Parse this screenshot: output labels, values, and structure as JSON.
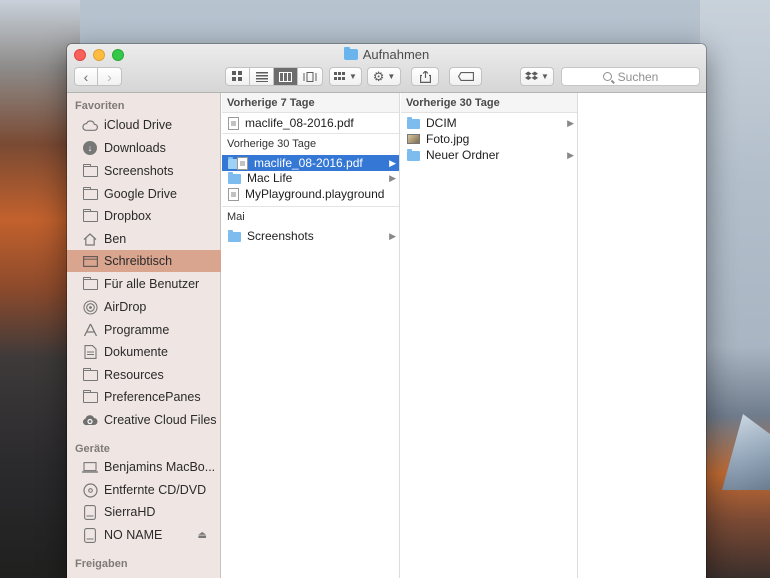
{
  "window": {
    "title": "Aufnahmen"
  },
  "toolbar": {
    "back": "‹",
    "forward": "›",
    "search_placeholder": "Suchen"
  },
  "sidebar": {
    "favorites_label": "Favoriten",
    "favorites": [
      {
        "label": "iCloud Drive",
        "icon": "cloud-icon"
      },
      {
        "label": "Downloads",
        "icon": "download-icon"
      },
      {
        "label": "Screenshots",
        "icon": "folder-icon"
      },
      {
        "label": "Google Drive",
        "icon": "folder-icon"
      },
      {
        "label": "Dropbox",
        "icon": "folder-icon"
      },
      {
        "label": "Ben",
        "icon": "home-icon"
      },
      {
        "label": "Schreibtisch",
        "icon": "desktop-icon",
        "selected": true
      },
      {
        "label": "Für alle Benutzer",
        "icon": "folder-icon"
      },
      {
        "label": "AirDrop",
        "icon": "airdrop-icon"
      },
      {
        "label": "Programme",
        "icon": "apps-icon"
      },
      {
        "label": "Dokumente",
        "icon": "document-icon"
      },
      {
        "label": "Resources",
        "icon": "folder-icon"
      },
      {
        "label": "PreferencePanes",
        "icon": "folder-icon"
      },
      {
        "label": "Creative Cloud Files",
        "icon": "creative-cloud-icon"
      }
    ],
    "devices_label": "Geräte",
    "devices": [
      {
        "label": "Benjamins MacBo...",
        "icon": "laptop-icon"
      },
      {
        "label": "Entfernte CD/DVD",
        "icon": "disc-icon"
      },
      {
        "label": "SierraHD",
        "icon": "disk-icon"
      },
      {
        "label": "NO NAME",
        "icon": "disk-icon",
        "ejectable": true
      }
    ],
    "shared_label": "Freigaben"
  },
  "columns": {
    "col1": {
      "header": "Vorherige 7 Tage",
      "group1": [
        {
          "name": "maclife_08-2016.pdf",
          "type": "pdf"
        }
      ],
      "sub_header": "Vorherige 30 Tage",
      "group2": [
        {
          "name": "maclife_08-2016.pdf",
          "type": "folder",
          "selected": true,
          "has_children": true
        },
        {
          "name": "Mac Life",
          "type": "folder",
          "has_children": true
        },
        {
          "name": "MyPlayground.playground",
          "type": "doc"
        }
      ],
      "sub_header2": "Mai",
      "group3": [
        {
          "name": "Screenshots",
          "type": "folder",
          "has_children": true
        }
      ]
    },
    "col2": {
      "header": "Vorherige 30 Tage",
      "items": [
        {
          "name": "DCIM",
          "type": "folder",
          "has_children": true
        },
        {
          "name": "Foto.jpg",
          "type": "image"
        },
        {
          "name": "Neuer Ordner",
          "type": "folder",
          "has_children": true
        }
      ]
    }
  }
}
